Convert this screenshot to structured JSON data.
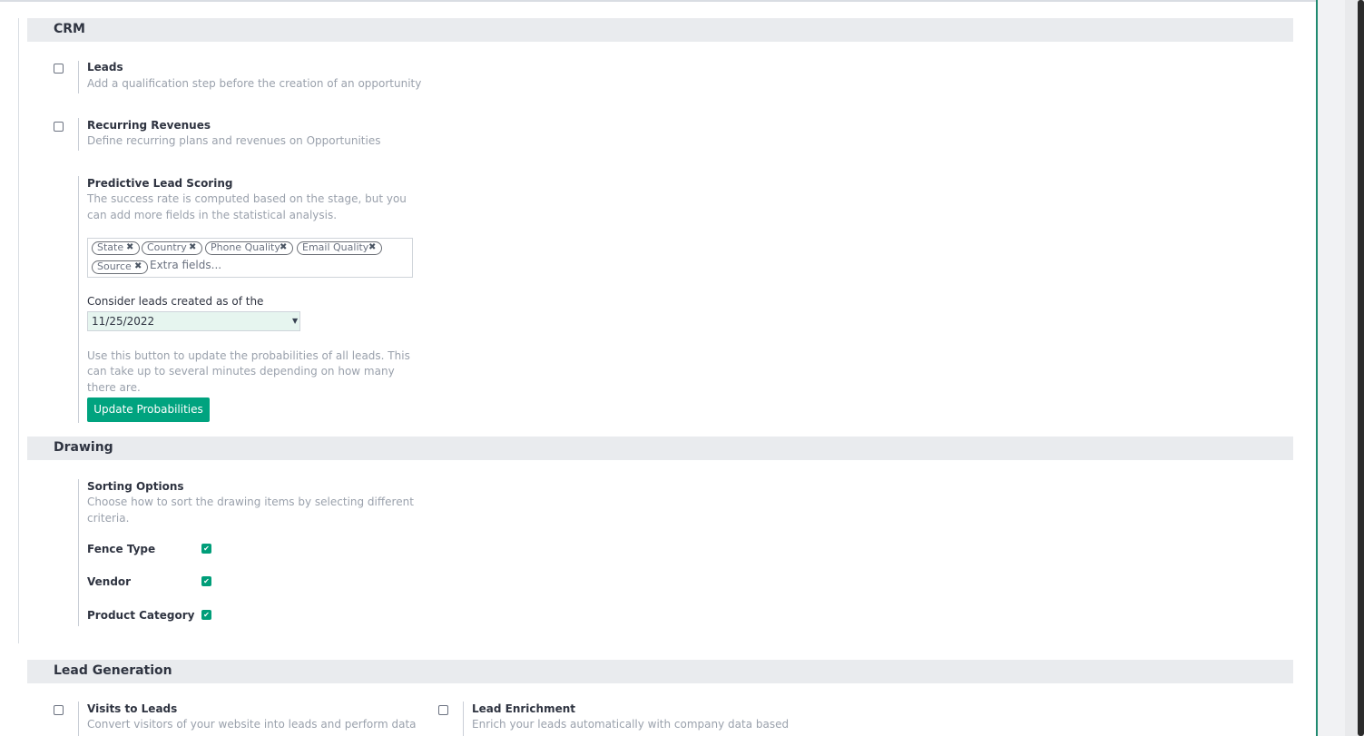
{
  "crm": {
    "header": "CRM",
    "leads": {
      "title": "Leads",
      "desc": "Add a qualification step before the creation of an opportunity"
    },
    "recurring": {
      "title": "Recurring Revenues",
      "desc": "Define recurring plans and revenues on Opportunities"
    },
    "pls": {
      "title": "Predictive Lead Scoring",
      "desc": [
        "The success rate is computed based on the stage, but you",
        "can add more fields in the statistical analysis."
      ],
      "tags": [
        "State",
        "Country",
        "Phone Quality",
        "Email Quality",
        "Source"
      ],
      "extra_placeholder": "Extra fields...",
      "date_label": "Consider leads created as of the",
      "date_value": "11/25/2022",
      "update_desc": [
        "Use this button to update the probabilities of all leads. This",
        "can take up to several minutes depending on how many",
        "there are."
      ],
      "update_button": "Update Probabilities"
    }
  },
  "drawing": {
    "header": "Drawing",
    "sorting": {
      "title": "Sorting Options",
      "desc": [
        "Choose how to sort the drawing items by selecting different",
        "criteria."
      ],
      "options": [
        {
          "label": "Fence Type",
          "checked": true
        },
        {
          "label": "Vendor",
          "checked": true
        },
        {
          "label": "Product Category",
          "checked": true
        }
      ]
    }
  },
  "lead_gen": {
    "header": "Lead Generation",
    "visits": {
      "title": "Visits to Leads",
      "desc": "Convert visitors of your website into leads and perform data"
    },
    "enrichment": {
      "title": "Lead Enrichment",
      "desc": "Enrich your leads automatically with company data based"
    }
  },
  "icons": {
    "remove_tag": "x-icon",
    "checkmark": "check-icon",
    "dropdown": "caret-down-icon"
  },
  "colors": {
    "primary": "#00a37f",
    "accent_border": "#1f8a70",
    "section_bg": "#e9ebee"
  }
}
